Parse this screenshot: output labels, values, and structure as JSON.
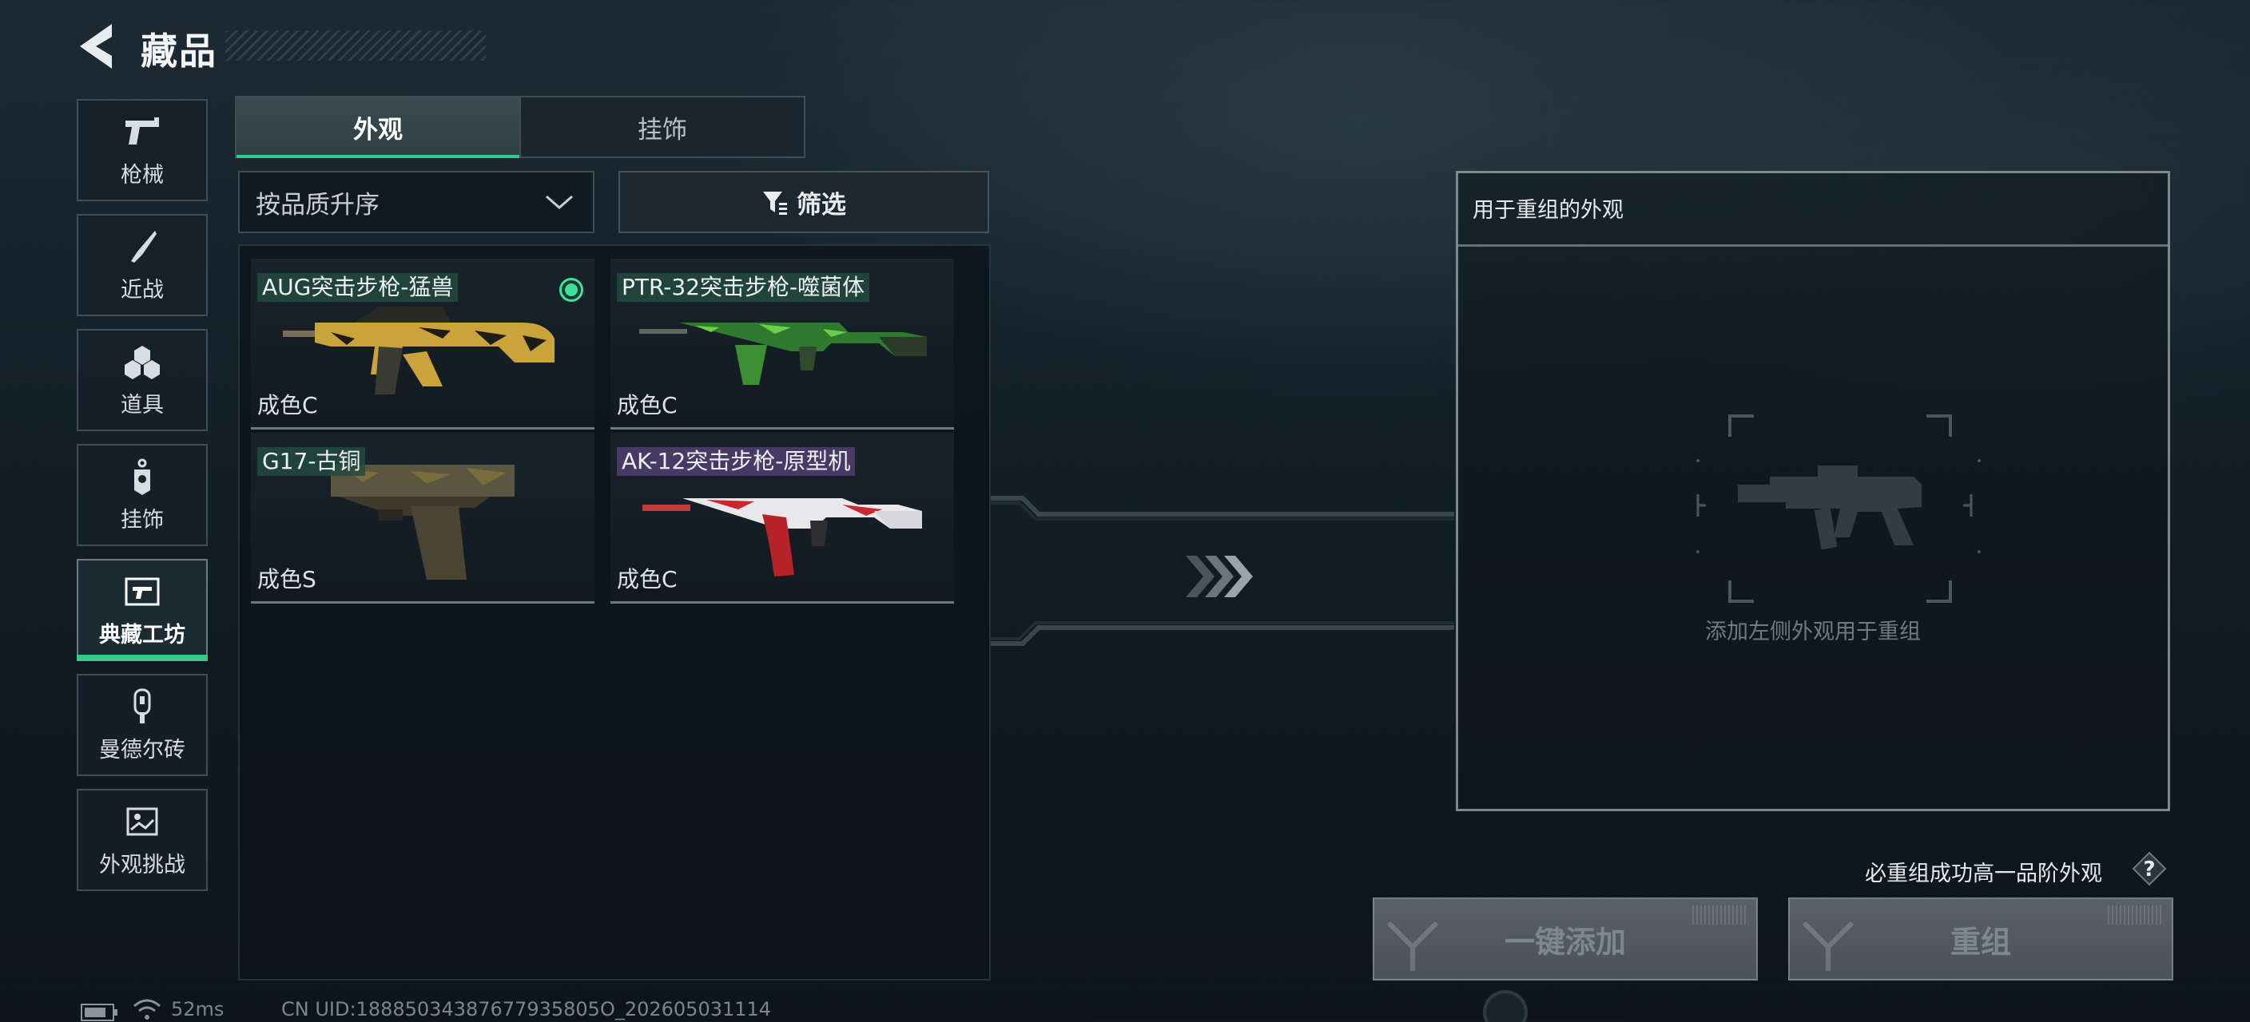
{
  "header": {
    "title": "藏品"
  },
  "sidebar": {
    "items": [
      {
        "label": "枪械",
        "icon": "pistol-icon"
      },
      {
        "label": "近战",
        "icon": "knife-icon"
      },
      {
        "label": "道具",
        "icon": "grenade-cluster-icon"
      },
      {
        "label": "挂饰",
        "icon": "charm-tag-icon"
      },
      {
        "label": "典藏工坊",
        "icon": "gun-frame-icon",
        "active": true
      },
      {
        "label": "曼德尔砖",
        "icon": "brick-key-icon"
      },
      {
        "label": "外观挑战",
        "icon": "challenge-image-icon"
      }
    ]
  },
  "tabs": [
    {
      "label": "外观",
      "active": true
    },
    {
      "label": "挂饰",
      "active": false
    }
  ],
  "sort": {
    "value": "按品质升序"
  },
  "filter": {
    "label": "筛选"
  },
  "items": [
    {
      "name": "AUG突击步枪-猛兽",
      "condition": "成色C",
      "selected": true,
      "tag_color": "green"
    },
    {
      "name": "PTR-32突击步枪-噬菌体",
      "condition": "成色C",
      "selected": false,
      "tag_color": "green"
    },
    {
      "name": "G17-古铜",
      "condition": "成色S",
      "selected": false,
      "tag_color": "green"
    },
    {
      "name": "AK-12突击步枪-原型机",
      "condition": "成色C",
      "selected": false,
      "tag_color": "purple"
    }
  ],
  "recombine": {
    "title": "用于重组的外观",
    "placeholder": "添加左侧外观用于重组"
  },
  "hint": {
    "text": "必重组成功高一品阶外观",
    "help": "?"
  },
  "actions": {
    "add_all": "一键添加",
    "recombine": "重组"
  },
  "status": {
    "ping": "52ms",
    "uid": "CN UID:18885034387677935805O_202605031114"
  },
  "colors": {
    "accent": "#35c98b",
    "selected_check": "#3fe09a",
    "purple_tag": "#503e6e"
  }
}
